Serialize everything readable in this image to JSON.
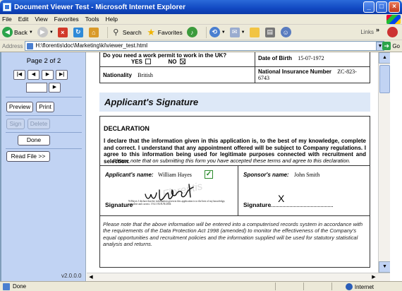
{
  "window": {
    "title": "Document Viewer Test - Microsoft Internet Explorer"
  },
  "menu": [
    "File",
    "Edit",
    "View",
    "Favorites",
    "Tools",
    "Help"
  ],
  "toolbar": {
    "back": "Back",
    "search": "Search",
    "favorites": "Favorites",
    "links": "Links"
  },
  "address": {
    "label": "Address",
    "url": "H:\\florentis\\doc\\Marketing\\ki\\viewer_test.html",
    "go": "Go"
  },
  "side": {
    "page_label": "Page 2 of 2",
    "nav": {
      "first": "|◀",
      "prev": "◀",
      "next": "▶",
      "last": "▶|",
      "go": "▶"
    },
    "preview": "Preview",
    "print": "Print",
    "sign": "Sign",
    "delete": "Delete",
    "done": "Done",
    "read_file": "Read File >>",
    "version": "v2.0.0.0"
  },
  "form": {
    "work_permit_q": "Do you need a work permit to work in the UK?",
    "yes": "YES",
    "no": "NO",
    "dob_label": "Date of Birth",
    "dob_value": "15-07-1972",
    "nationality_label": "Nationality",
    "nationality_value": "British",
    "ni_label": "National Insurance Number",
    "ni_value": "ZC-823-6743"
  },
  "signature_section": {
    "heading": "Applicant's Signature",
    "decl_title": "DECLARATION",
    "decl_body": "I declare that the information given in this application is, to the best of my knowledge, complete and correct. I understand that any appointment offered will be subject to Company regulations. I agree to this information being used for legitimate purposes connected with recruitment and selection.",
    "decl_note": "Please note that on submitting this form you have accepted these terms and agree to this declaration.",
    "applicant_label": "Applicant's name:",
    "applicant_value": "William Hayes",
    "sponsor_label": "Sponsor's name:",
    "sponsor_value": "John Smith",
    "signature_label": "Signature",
    "sponsor_sig_mark": "X",
    "sig_stamp": "W.Hayes I declare that the information given in this application is to the best of my knowledge, complete and correct. 19:21 05/JUN/2004",
    "footer": "Please note that the above information will be entered into a computerised records system in accordance with the requirements of the Data Protection Act 1998 (amended) to monitor the effectiveness of the Company's equal opportunities and recruitment policies and the information supplied will be used for statutory statistical analysis and returns."
  },
  "status": {
    "left": "Done",
    "zone": "Internet"
  }
}
